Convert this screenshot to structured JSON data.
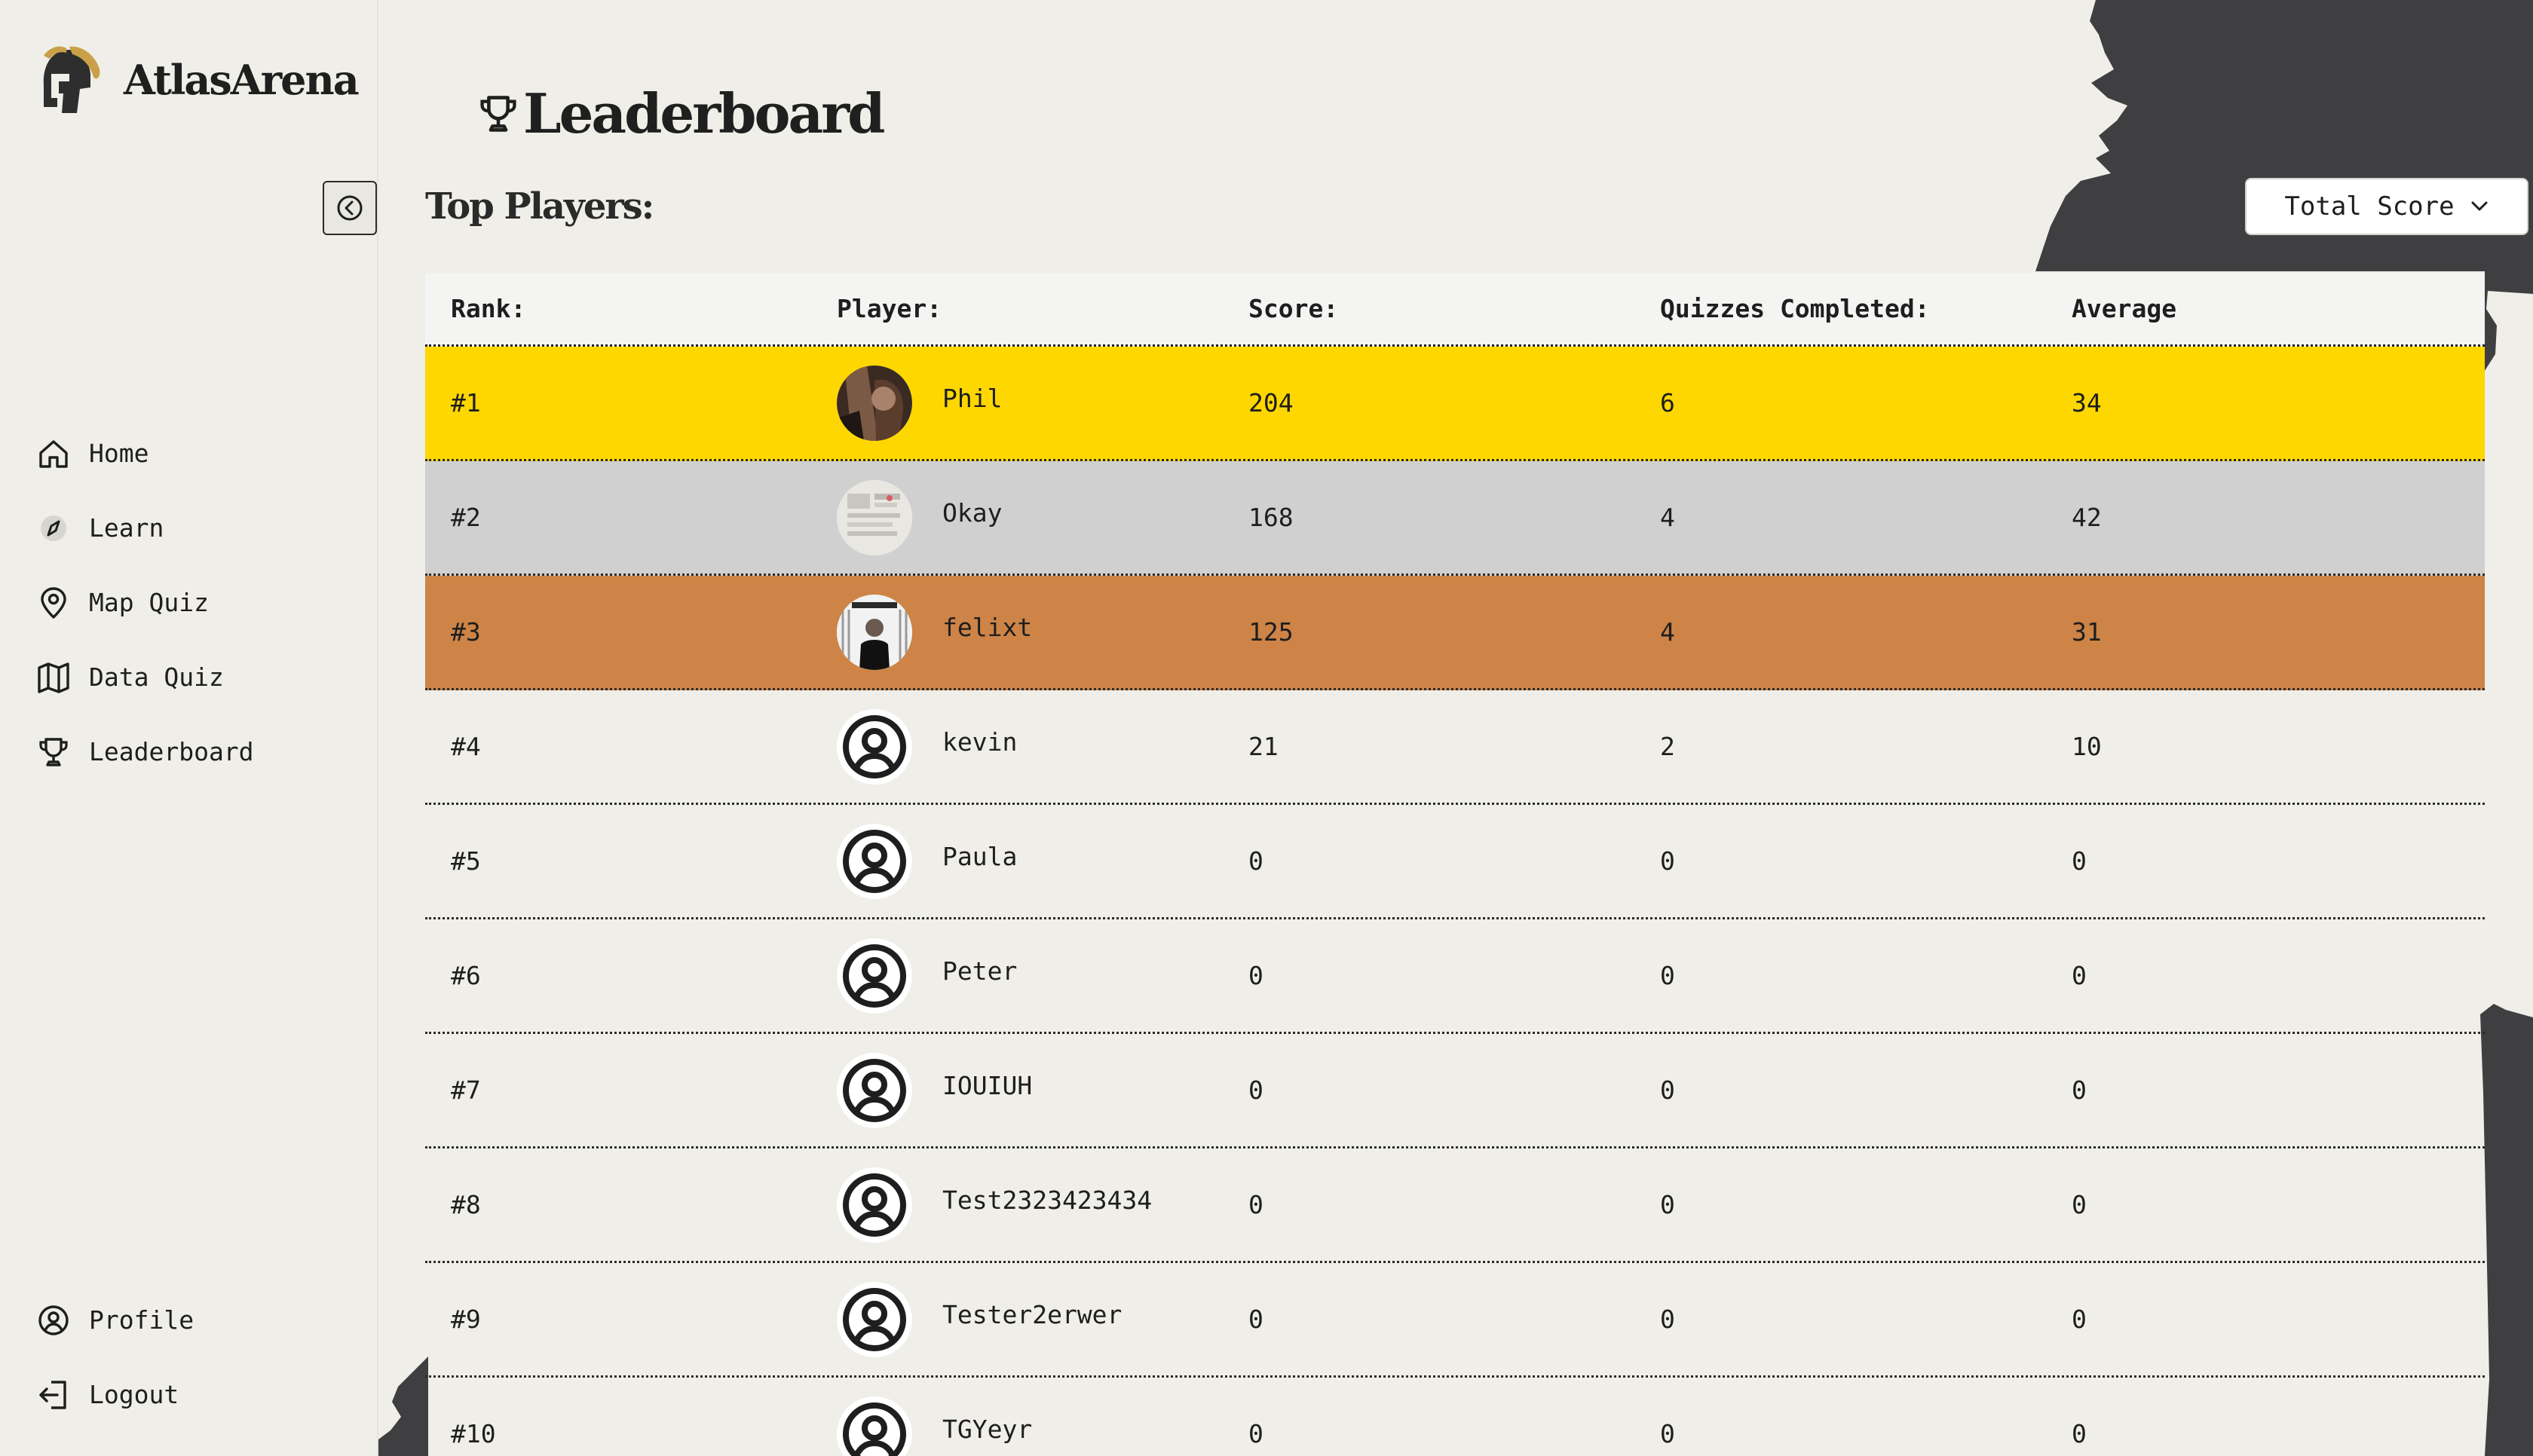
{
  "brand": {
    "name": "AtlasArena"
  },
  "sidebar": {
    "items": [
      {
        "label": "Home",
        "icon": "home-icon"
      },
      {
        "label": "Learn",
        "icon": "compass-icon"
      },
      {
        "label": "Map Quiz",
        "icon": "map-pin-icon"
      },
      {
        "label": "Data Quiz",
        "icon": "map-icon"
      },
      {
        "label": "Leaderboard",
        "icon": "trophy-icon"
      }
    ],
    "bottom": [
      {
        "label": "Profile",
        "icon": "user-circle-icon"
      },
      {
        "label": "Logout",
        "icon": "logout-icon"
      }
    ]
  },
  "page": {
    "title": "Leaderboard",
    "section_title": "Top Players:"
  },
  "sort": {
    "selected": "Total Score"
  },
  "table": {
    "headers": [
      "Rank:",
      "Player:",
      "Score:",
      "Quizzes Completed:",
      "Average"
    ],
    "rows": [
      {
        "rank": "#1",
        "player": "Phil",
        "score": "204",
        "quizzes": "6",
        "average": "34",
        "avatar": "photo"
      },
      {
        "rank": "#2",
        "player": "Okay",
        "score": "168",
        "quizzes": "4",
        "average": "42",
        "avatar": "photo"
      },
      {
        "rank": "#3",
        "player": "felixt",
        "score": "125",
        "quizzes": "4",
        "average": "31",
        "avatar": "photo"
      },
      {
        "rank": "#4",
        "player": "kevin",
        "score": "21",
        "quizzes": "2",
        "average": "10",
        "avatar": "default"
      },
      {
        "rank": "#5",
        "player": "Paula",
        "score": "0",
        "quizzes": "0",
        "average": "0",
        "avatar": "default"
      },
      {
        "rank": "#6",
        "player": "Peter",
        "score": "0",
        "quizzes": "0",
        "average": "0",
        "avatar": "default"
      },
      {
        "rank": "#7",
        "player": "IOUIUH",
        "score": "0",
        "quizzes": "0",
        "average": "0",
        "avatar": "default"
      },
      {
        "rank": "#8",
        "player": "Test2323423434",
        "score": "0",
        "quizzes": "0",
        "average": "0",
        "avatar": "default"
      },
      {
        "rank": "#9",
        "player": "Tester2erwer",
        "score": "0",
        "quizzes": "0",
        "average": "0",
        "avatar": "default"
      },
      {
        "rank": "#10",
        "player": "TGYeyr",
        "score": "0",
        "quizzes": "0",
        "average": "0",
        "avatar": "default"
      }
    ]
  },
  "colors": {
    "background": "#efeee8",
    "gold": "#ffd700",
    "silver": "#d0d0d0",
    "bronze": "#cd8446",
    "silhouette": "#3f3e40"
  }
}
